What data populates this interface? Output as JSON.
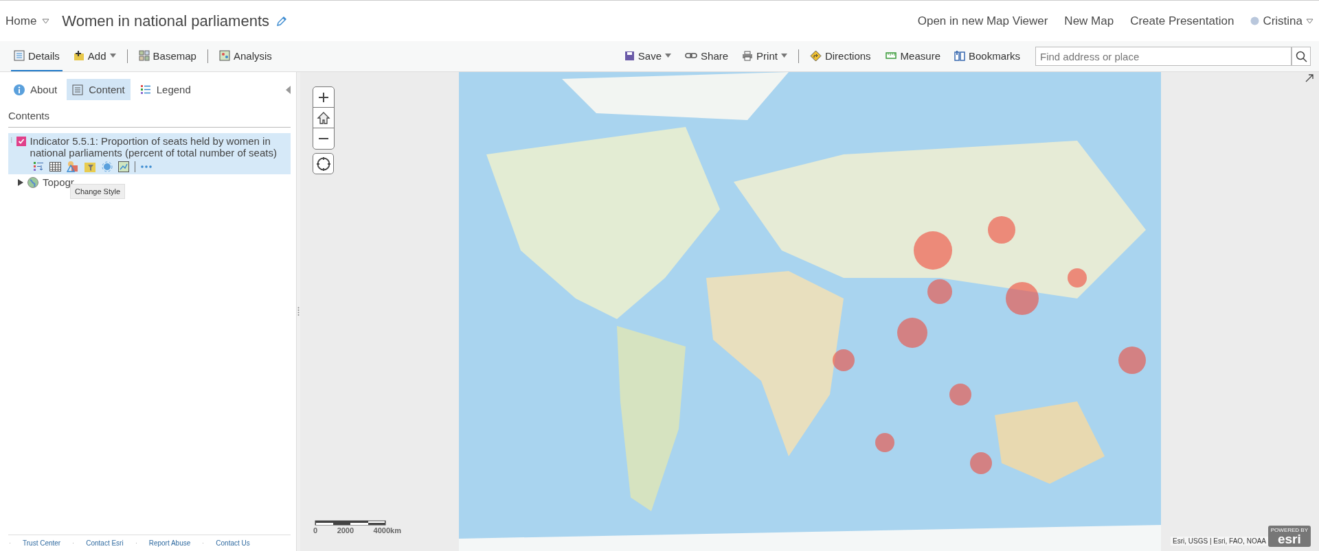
{
  "header": {
    "home": "Home",
    "title": "Women in national parliaments",
    "links": [
      "Open in new Map Viewer",
      "New Map",
      "Create Presentation"
    ],
    "user": "Cristina"
  },
  "toolbar": {
    "left": [
      {
        "label": "Details",
        "dropdown": false,
        "selected": true
      },
      {
        "label": "Add",
        "dropdown": true,
        "selected": false
      },
      {
        "label": "Basemap",
        "dropdown": false,
        "selected": false
      },
      {
        "label": "Analysis",
        "dropdown": false,
        "selected": false
      }
    ],
    "right": [
      {
        "label": "Save",
        "dropdown": true
      },
      {
        "label": "Share",
        "dropdown": false
      },
      {
        "label": "Print",
        "dropdown": true
      },
      {
        "label": "Directions",
        "dropdown": false
      },
      {
        "label": "Measure",
        "dropdown": false
      },
      {
        "label": "Bookmarks",
        "dropdown": false
      }
    ],
    "search": {
      "placeholder": "Find address or place"
    }
  },
  "panel": {
    "tabs": [
      {
        "label": "About",
        "selected": false
      },
      {
        "label": "Content",
        "selected": true
      },
      {
        "label": "Legend",
        "selected": false
      }
    ],
    "heading": "Contents",
    "layers": [
      {
        "kind": "feature",
        "name": "Indicator 5.5.1: Proportion of seats held by women in national parliaments (percent of total number of seats)",
        "checked": true,
        "selected": true
      },
      {
        "kind": "basemap",
        "name": "Topogr",
        "expanded": false,
        "selected": false
      }
    ],
    "tooltip": "Change Style",
    "footer": [
      "Trust Center",
      "Contact Esri",
      "Report Abuse",
      "Contact Us"
    ]
  },
  "map": {
    "scale": [
      "0",
      "2000",
      "4000km"
    ],
    "attribution": "Esri, USGS | Esri, FAO, NOAA",
    "logo": {
      "top": "POWERED BY",
      "word": "esri"
    }
  }
}
